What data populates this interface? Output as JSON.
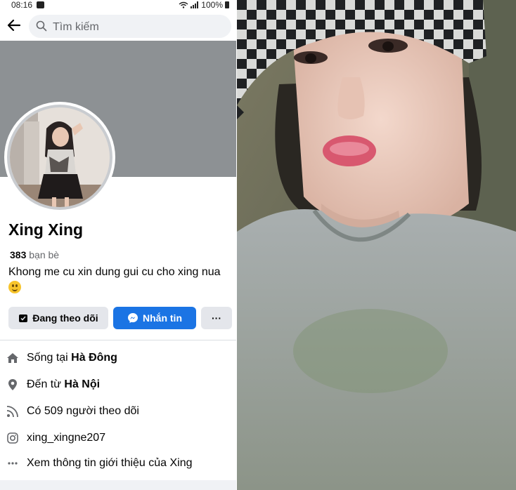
{
  "status_bar": {
    "time": "08:16",
    "battery": "100%"
  },
  "search": {
    "placeholder": "Tìm kiếm"
  },
  "profile": {
    "name": "Xing Xing",
    "friends_count": "383",
    "friends_label": "bạn bè",
    "bio": "Khong me cu xin dung gui cu cho xing nua"
  },
  "actions": {
    "following_label": "Đang theo dõi",
    "message_label": "Nhắn tin",
    "more_label": "···"
  },
  "details": {
    "lives_prefix": "Sống tại",
    "lives_place": "Hà Đông",
    "from_prefix": "Đến từ",
    "from_place": "Hà Nội",
    "followers_text": "Có 509 người theo dõi",
    "instagram": "xing_xingne207",
    "see_about": "Xem thông tin giới thiệu của Xing"
  },
  "colors": {
    "accent": "#1b74e4",
    "cover": "#8d9194",
    "button_gray": "#e4e6eb"
  }
}
